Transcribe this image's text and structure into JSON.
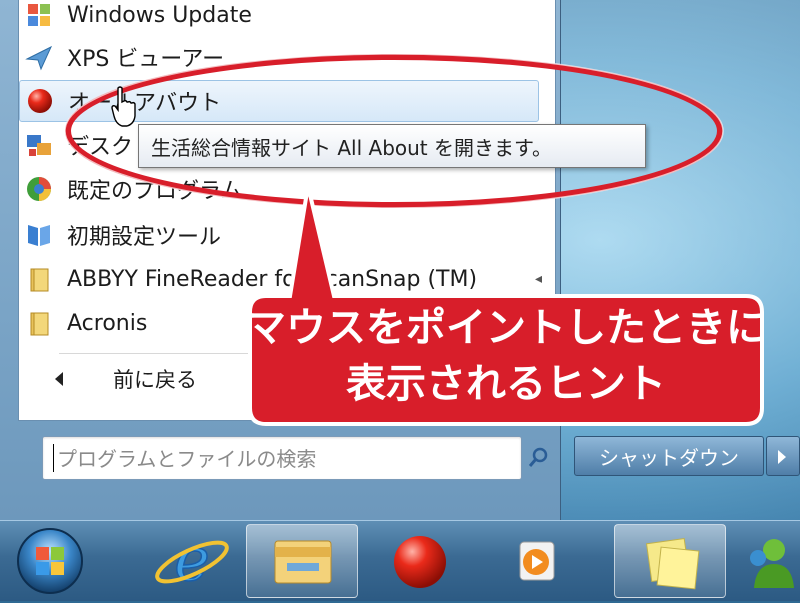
{
  "start_menu": {
    "programs": [
      {
        "label": "Windows Update",
        "icon": "windows-update-icon"
      },
      {
        "label": "XPS ビューアー",
        "icon": "xps-viewer-icon"
      },
      {
        "label": "オールアバウト",
        "icon": "red-ball-icon"
      },
      {
        "label": "デスクト",
        "icon": "desktop-gadget-icon"
      },
      {
        "label": "既定のプログラム",
        "icon": "default-programs-icon"
      },
      {
        "label": "初期設定ツール",
        "icon": "setup-tool-icon"
      },
      {
        "label": "ABBYY FineReader for ScanSnap (TM)",
        "icon": "folder-icon"
      },
      {
        "label": "Acronis",
        "icon": "folder-icon"
      }
    ],
    "back_label": "前に戻る",
    "search_placeholder": "プログラムとファイルの検索",
    "shutdown_label": "シャットダウン"
  },
  "tooltip": {
    "text": "生活総合情報サイト All About を開きます。"
  },
  "annotation": {
    "line1": "マウスをポイントしたときに",
    "line2": "表示されるヒント",
    "color": "#d81e2a"
  },
  "taskbar": {
    "items": [
      {
        "icon": "start-orb-icon"
      },
      {
        "icon": "internet-explorer-icon"
      },
      {
        "icon": "windows-explorer-icon"
      },
      {
        "icon": "red-ball-icon"
      },
      {
        "icon": "media-player-icon"
      },
      {
        "icon": "sticky-notes-icon"
      },
      {
        "icon": "messenger-icon"
      }
    ]
  }
}
